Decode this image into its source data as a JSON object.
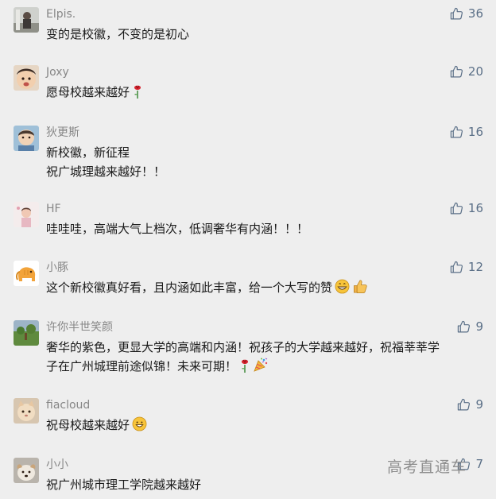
{
  "colors": {
    "background": "#eeeeee",
    "nickname": "#878787",
    "text": "#1a1a1a",
    "like": "#5a6f87"
  },
  "like_icon": "thumbs-up-outline-icon",
  "comments": [
    {
      "nickname": "Elpis.",
      "lines": [
        "变的是校徽，不变的是初心"
      ],
      "likes": "36"
    },
    {
      "nickname": "Joxy",
      "lines": [
        "愿母校越来越好"
      ],
      "emoji": [
        "rose-icon"
      ],
      "likes": "20"
    },
    {
      "nickname": "狄更斯",
      "lines": [
        "新校徽，新征程",
        "祝广城理越来越好！！"
      ],
      "likes": "16"
    },
    {
      "nickname": "HF",
      "lines": [
        "哇哇哇，高端大气上档次，低调奢华有内涵！！！"
      ],
      "likes": "16"
    },
    {
      "nickname": "小豚",
      "lines": [
        "这个新校徽真好看，且内涵如此丰富，给一个大写的赞"
      ],
      "emoji": [
        "grin-icon",
        "thumbs-up-emoji-icon"
      ],
      "likes": "12"
    },
    {
      "nickname": "许你半世笑颜",
      "lines": [
        "奢华的紫色，更显大学的高端和内涵！祝孩子的大学越来越好，祝福莘莘学",
        "子在广州城理前途似锦！未来可期！"
      ],
      "emoji": [
        "rose-icon",
        "party-popper-icon"
      ],
      "likes": "9"
    },
    {
      "nickname": "fiacloud",
      "lines": [
        "祝母校越来越好"
      ],
      "emoji": [
        "smile-icon"
      ],
      "likes": "9"
    },
    {
      "nickname": "小小",
      "lines": [
        "祝广州城市理工学院越来越好"
      ],
      "likes": "7"
    }
  ],
  "watermark": "高考直通车"
}
